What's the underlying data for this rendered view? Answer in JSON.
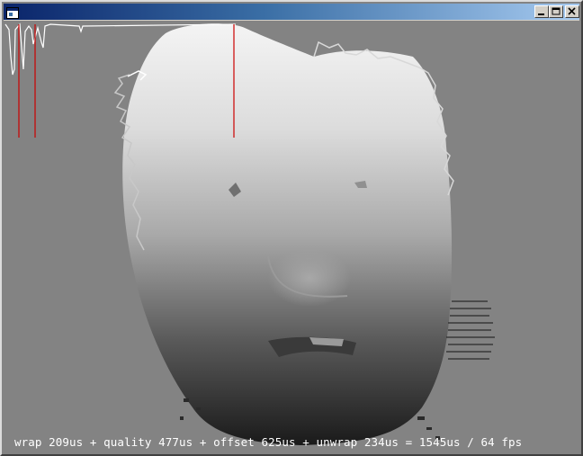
{
  "window": {
    "title": "",
    "icons": {
      "system": "window-app-icon",
      "minimize": "minimize-icon",
      "maximize": "maximize-icon",
      "close": "close-icon"
    }
  },
  "view": {
    "content": "depth-map-face",
    "background_color": "#838383",
    "marker_color": "#cc0000"
  },
  "status": {
    "timing_text": "wrap 209us + quality 477us + offset 625us + unwrap 234us = 1545us / 64 fps"
  }
}
